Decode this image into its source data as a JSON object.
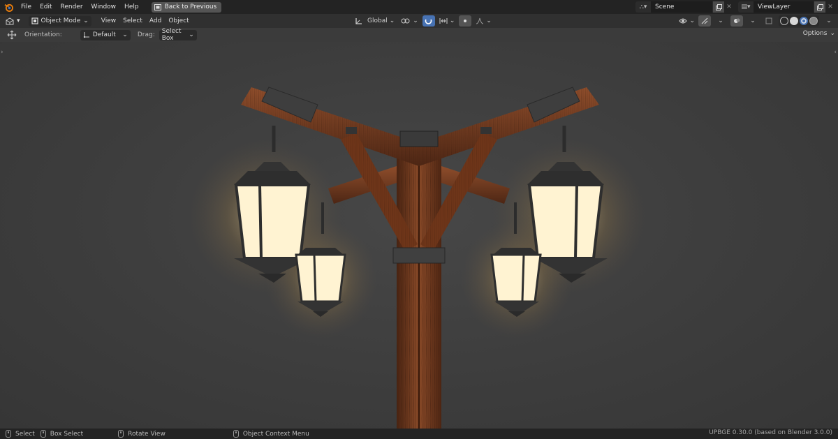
{
  "menu": {
    "items": [
      "File",
      "Edit",
      "Render",
      "Window",
      "Help"
    ],
    "back_button": "Back to Previous"
  },
  "scene": {
    "label": "Scene"
  },
  "view_layer": {
    "label": "ViewLayer"
  },
  "header": {
    "mode": "Object Mode",
    "menus": [
      "View",
      "Select",
      "Add",
      "Object"
    ],
    "orientation_global": "Global"
  },
  "tool_settings": {
    "orientation_label": "Orientation:",
    "orientation_value": "Default",
    "drag_label": "Drag:",
    "drag_value": "Select Box",
    "options_label": "Options"
  },
  "status": {
    "select": "Select",
    "box_select": "Box Select",
    "rotate_view": "Rotate View",
    "context_menu": "Object Context Menu",
    "version": "UPBGE 0.30.0 (based on Blender 3.0.0)"
  },
  "colors": {
    "accent": "#4772b3",
    "lantern_glow": "#fff3d2",
    "wood": "#7a3f22",
    "logo": "#e87d0d"
  }
}
